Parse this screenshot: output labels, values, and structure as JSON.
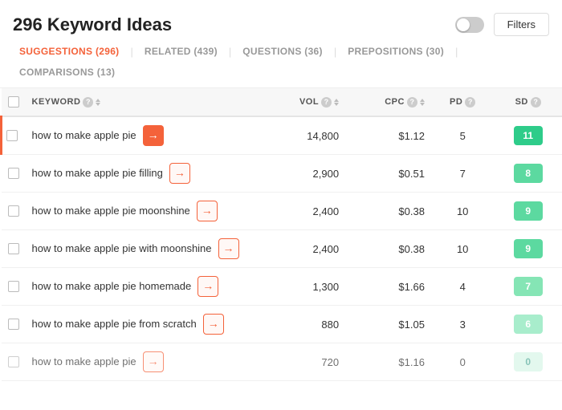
{
  "header": {
    "title": "296 Keyword Ideas",
    "filters_label": "Filters"
  },
  "tabs": [
    {
      "id": "suggestions",
      "label": "SUGGESTIONS (296)",
      "active": true
    },
    {
      "id": "related",
      "label": "RELATED (439)",
      "active": false
    },
    {
      "id": "questions",
      "label": "QUESTIONS (36)",
      "active": false
    },
    {
      "id": "prepositions",
      "label": "PREPOSITIONS (30)",
      "active": false
    },
    {
      "id": "comparisons",
      "label": "COMPARISONS (13)",
      "active": false
    }
  ],
  "table": {
    "columns": [
      {
        "id": "keyword",
        "label": "KEYWORD"
      },
      {
        "id": "vol",
        "label": "VOL"
      },
      {
        "id": "cpc",
        "label": "CPC"
      },
      {
        "id": "pd",
        "label": "PD"
      },
      {
        "id": "sd",
        "label": "SD"
      }
    ],
    "rows": [
      {
        "keyword": "how to make apple pie",
        "vol": "14,800",
        "cpc": "$1.12",
        "pd": "5",
        "sd": "11",
        "sd_class": "sd-green-strong",
        "highlighted": true
      },
      {
        "keyword": "how to make apple pie filling",
        "vol": "2,900",
        "cpc": "$0.51",
        "pd": "7",
        "sd": "8",
        "sd_class": "sd-green-mid",
        "highlighted": false
      },
      {
        "keyword": "how to make apple pie moonshine",
        "vol": "2,400",
        "cpc": "$0.38",
        "pd": "10",
        "sd": "9",
        "sd_class": "sd-green-mid",
        "highlighted": false
      },
      {
        "keyword": "how to make apple pie with moonshine",
        "vol": "2,400",
        "cpc": "$0.38",
        "pd": "10",
        "sd": "9",
        "sd_class": "sd-green-mid",
        "highlighted": false
      },
      {
        "keyword": "how to make apple pie homemade",
        "vol": "1,300",
        "cpc": "$1.66",
        "pd": "4",
        "sd": "7",
        "sd_class": "sd-green-light",
        "highlighted": false
      },
      {
        "keyword": "how to make apple pie from scratch",
        "vol": "880",
        "cpc": "$1.05",
        "pd": "3",
        "sd": "6",
        "sd_class": "sd-green-lighter",
        "highlighted": false
      },
      {
        "keyword": "how to make apple pie",
        "vol": "720",
        "cpc": "$1.16",
        "pd": "0",
        "sd": "0",
        "sd_class": "sd-green-paler",
        "highlighted": false,
        "partial": true
      }
    ]
  }
}
